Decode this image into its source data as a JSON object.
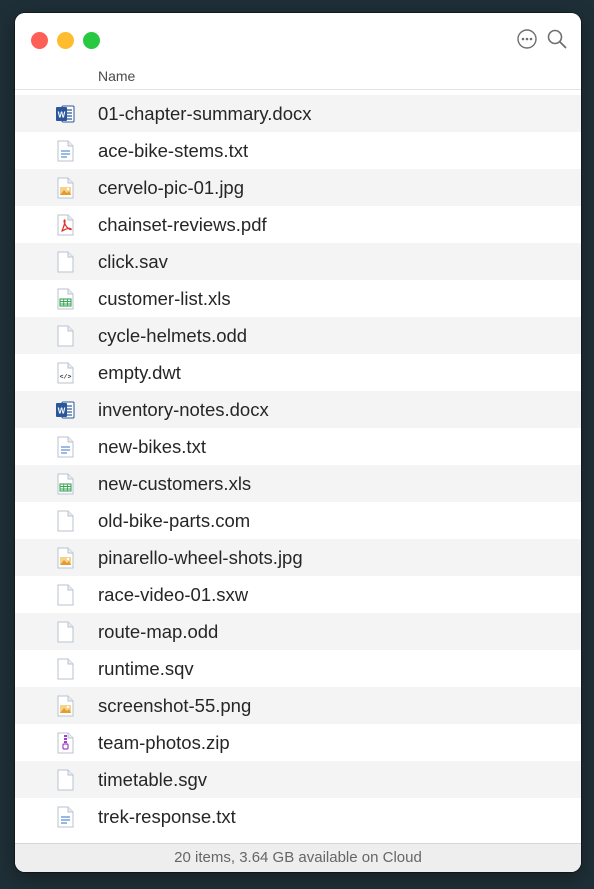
{
  "window": {
    "traffic_colors": {
      "close": "#fe5f57",
      "minimize": "#febc2e",
      "zoom": "#28c840"
    },
    "tools": [
      {
        "name": "more-options-icon"
      },
      {
        "name": "search-icon"
      }
    ]
  },
  "header": {
    "name_label": "Name"
  },
  "files": [
    {
      "name": "01-chapter-summary.docx",
      "type": "word"
    },
    {
      "name": "ace-bike-stems.txt",
      "type": "text"
    },
    {
      "name": "cervelo-pic-01.jpg",
      "type": "image"
    },
    {
      "name": "chainset-reviews.pdf",
      "type": "pdf"
    },
    {
      "name": "click.sav",
      "type": "generic"
    },
    {
      "name": "customer-list.xls",
      "type": "spreadsheet"
    },
    {
      "name": "cycle-helmets.odd",
      "type": "generic"
    },
    {
      "name": "empty.dwt",
      "type": "code"
    },
    {
      "name": "inventory-notes.docx",
      "type": "word"
    },
    {
      "name": "new-bikes.txt",
      "type": "text"
    },
    {
      "name": "new-customers.xls",
      "type": "spreadsheet"
    },
    {
      "name": "old-bike-parts.com",
      "type": "generic"
    },
    {
      "name": "pinarello-wheel-shots.jpg",
      "type": "image"
    },
    {
      "name": "race-video-01.sxw",
      "type": "generic"
    },
    {
      "name": "route-map.odd",
      "type": "generic"
    },
    {
      "name": "runtime.sqv",
      "type": "generic"
    },
    {
      "name": "screenshot-55.png",
      "type": "image"
    },
    {
      "name": "team-photos.zip",
      "type": "archive"
    },
    {
      "name": "timetable.sgv",
      "type": "generic"
    },
    {
      "name": "trek-response.txt",
      "type": "text"
    }
  ],
  "status": {
    "text": "20 items, 3.64 GB available on Cloud"
  }
}
